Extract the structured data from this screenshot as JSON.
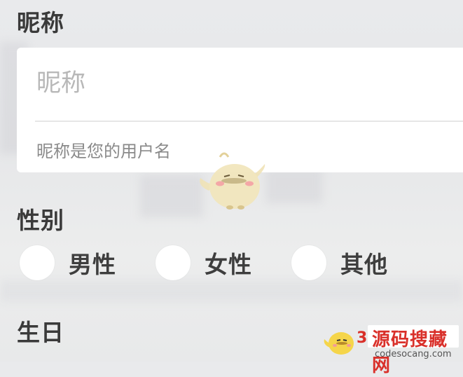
{
  "form": {
    "nickname": {
      "label": "昵称",
      "placeholder": "昵称",
      "value": "",
      "hint": "昵称是您的用户名"
    },
    "gender": {
      "label": "性别",
      "options": [
        {
          "label": "男性",
          "selected": false
        },
        {
          "label": "女性",
          "selected": false
        },
        {
          "label": "其他",
          "selected": false
        }
      ]
    },
    "birthday": {
      "label": "生日"
    }
  },
  "watermark": {
    "title": "源码搜藏网",
    "number": "3",
    "url": "codesocang.com"
  },
  "colors": {
    "background": "#e8e9eb",
    "card": "#ffffff",
    "label": "#3a3a3a",
    "placeholder": "#b8b8b8",
    "watermark": "#d9302a"
  },
  "icons": [
    "mascot-icon",
    "watermark-logo-icon"
  ]
}
